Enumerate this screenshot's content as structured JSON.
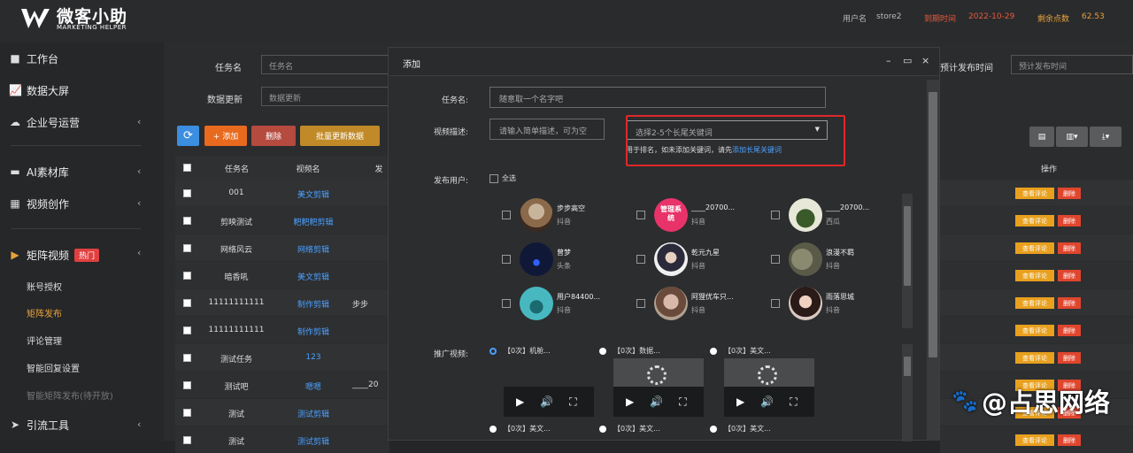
{
  "header": {
    "title": "微客小助",
    "subtitle": "MARKETING HELPER",
    "username_label": "用户名",
    "username": "store2",
    "expire_label": "到期时间",
    "expire_date": "2022-10-29",
    "points_label": "剩余点数",
    "points": "62.53"
  },
  "sidebar": {
    "items": [
      {
        "label": "工作台",
        "icon": "monitor-icon"
      },
      {
        "label": "数据大屏",
        "icon": "chart-icon"
      },
      {
        "label": "企业号运营",
        "icon": "cloud-icon"
      },
      {
        "label": "AI素材库",
        "icon": "folder-icon"
      },
      {
        "label": "视频创作",
        "icon": "film-icon"
      },
      {
        "label": "矩阵视频",
        "icon": "video-icon",
        "badge": "热门"
      },
      {
        "label": "引流工具",
        "icon": "send-icon"
      }
    ],
    "sub_items": [
      "账号授权",
      "矩阵发布",
      "评论管理",
      "智能回复设置",
      "智能矩阵发布(待开放)"
    ]
  },
  "filters": {
    "task_name_label": "任务名",
    "task_name_placeholder": "任务名",
    "data_update_label": "数据更新",
    "data_update_placeholder": "数据更新",
    "plan_time_label": "预计发布时间",
    "plan_time_placeholder": "预计发布时间"
  },
  "toolbar": {
    "refresh": "⟳",
    "add": "+ 添加",
    "delete": "删除",
    "batch": "批量更新数据"
  },
  "table": {
    "headers": [
      "任务名",
      "视频名",
      "发"
    ],
    "ops_header": "操作",
    "rows": [
      {
        "task": "001",
        "video": "美文剪辑",
        "extra": ""
      },
      {
        "task": "剪映测试",
        "video": "粑粑粑剪辑",
        "extra": ""
      },
      {
        "task": "网络风云",
        "video": "网络剪辑",
        "extra": ""
      },
      {
        "task": "暗香吼",
        "video": "美文剪辑",
        "extra": ""
      },
      {
        "task": "11111111111",
        "video": "制作剪辑",
        "extra": "步步"
      },
      {
        "task": "11111111111",
        "video": "制作剪辑",
        "extra": ""
      },
      {
        "task": "测试任务",
        "video": "123",
        "extra": ""
      },
      {
        "task": "测试吧",
        "video": "嗯嗯",
        "extra": "____20"
      },
      {
        "task": "测试",
        "video": "测试剪辑",
        "extra": ""
      },
      {
        "task": "测试",
        "video": "测试剪辑",
        "extra": ""
      }
    ],
    "op_edit": "查看评论",
    "op_del": "删除"
  },
  "modal": {
    "title": "添加",
    "task_label": "任务名:",
    "task_placeholder": "随意取一个名字吧",
    "keyword_label": "视频描述:",
    "keyword_placeholder": "请输入简单描述，可为空",
    "select_placeholder": "选择2-5个长尾关键词",
    "hint_prefix": "用于排名，如未添加关键词，请先",
    "hint_link": "添加长尾关键词",
    "publish_label": "发布用户:",
    "select_all": "全选",
    "users": [
      {
        "name": "步步高空",
        "platform": "抖音"
      },
      {
        "name": "____20700...",
        "platform": "抖音"
      },
      {
        "name": "____20700...",
        "platform": "西瓜"
      },
      {
        "name": "曾梦",
        "platform": "头条"
      },
      {
        "name": "乾元九星",
        "platform": "抖音"
      },
      {
        "name": "浪漫不羁",
        "platform": "抖音"
      },
      {
        "name": "用户84400...",
        "platform": "抖音"
      },
      {
        "name": "阿狸优车只...",
        "platform": "抖音"
      },
      {
        "name": "雨落思城",
        "platform": "抖音"
      }
    ],
    "logo_text": "管理系统",
    "video_label": "推广视频:",
    "videos": [
      "【0次】机舱...",
      "【0次】数据...",
      "【0次】美文...",
      "【0次】美文...",
      "【0次】美文...",
      "【0次】美文..."
    ]
  },
  "watermark": "@占思网络"
}
